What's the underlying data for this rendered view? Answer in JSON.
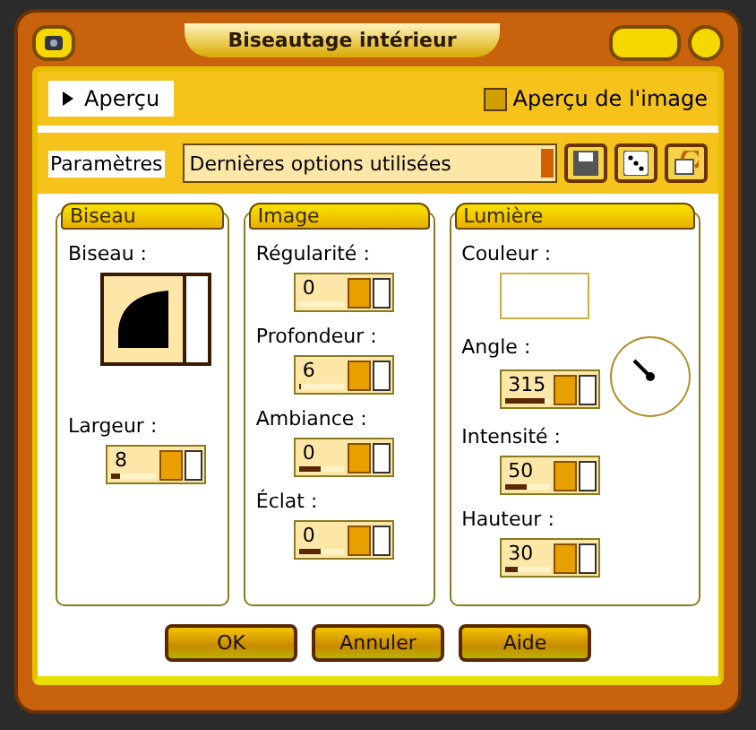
{
  "window": {
    "title": "Biseautage intérieur"
  },
  "preview": {
    "label": "Aperçu",
    "expanded": false,
    "image_preview": {
      "label": "Aperçu de l'image",
      "checked": true
    }
  },
  "parameters": {
    "label": "Paramètres",
    "value": "Dernières options utilisées"
  },
  "panels": [
    {
      "title": "Biseau",
      "fields": [
        {
          "kind": "bevel",
          "label": "Biseau :"
        },
        {
          "kind": "spin",
          "label": "Largeur :",
          "value": "8",
          "level": 0.2
        }
      ]
    },
    {
      "title": "Image",
      "fields": [
        {
          "kind": "spin",
          "label": "Régularité :",
          "value": "0",
          "level": 0
        },
        {
          "kind": "spin",
          "label": "Profondeur :",
          "value": "6",
          "level": 0.03
        },
        {
          "kind": "spin",
          "label": "Ambiance :",
          "value": "0",
          "level": 0.5
        },
        {
          "kind": "spin",
          "label": "Éclat :",
          "value": "0",
          "level": 0.5
        }
      ]
    },
    {
      "title": "Lumière",
      "fields": [
        {
          "kind": "color",
          "label": "Couleur :"
        },
        {
          "kind": "angle",
          "label": "Angle :",
          "value": "315"
        },
        {
          "kind": "spin",
          "label": "Intensité :",
          "value": "50",
          "level": 0.5
        },
        {
          "kind": "spin",
          "label": "Hauteur :",
          "value": "30",
          "level": 0.3
        }
      ]
    }
  ],
  "buttons": [
    "OK",
    "Annuler",
    "Aide"
  ]
}
